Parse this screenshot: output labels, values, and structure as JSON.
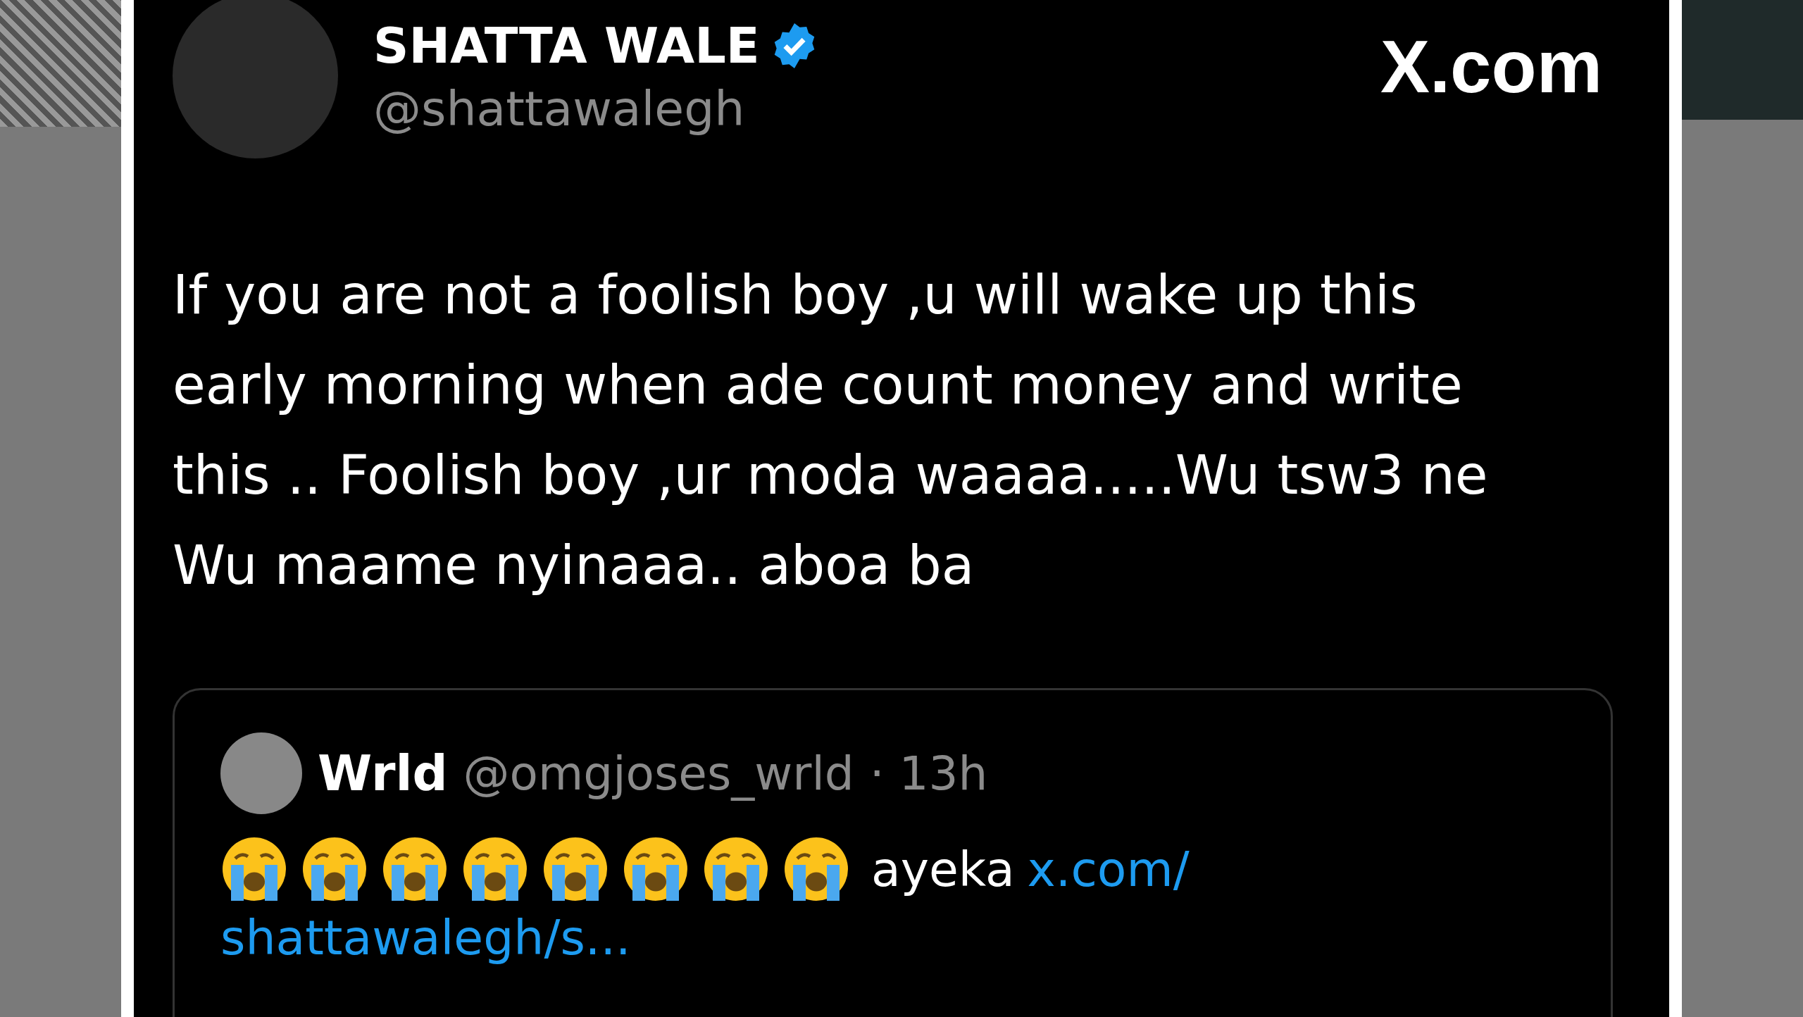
{
  "tweet": {
    "author": {
      "name": "SHATTA WALE",
      "verified": true,
      "handle": "@shattawalegh"
    },
    "site_logo": "X.com",
    "text_lines": [
      "If you are not a foolish boy ,u will wake up this",
      "early morning when ade count money and write",
      "this .. Foolish boy ,ur moda waaaa.....Wu tsw3 ne",
      "Wu maame nyinaaa.. aboa ba"
    ],
    "quote": {
      "author": {
        "name": "Wrld",
        "handle": "@omgjoses_wrld",
        "time": "· 13h"
      },
      "emojis": [
        {
          "kind": "crying"
        },
        {
          "kind": "crying"
        },
        {
          "kind": "crying"
        },
        {
          "kind": "crying"
        },
        {
          "kind": "crying"
        },
        {
          "kind": "crying"
        },
        {
          "kind": "crying"
        },
        {
          "kind": "crying"
        }
      ],
      "text": "ayeka",
      "link_lines": [
        "x.com/",
        "shattawalegh/s..."
      ]
    }
  }
}
